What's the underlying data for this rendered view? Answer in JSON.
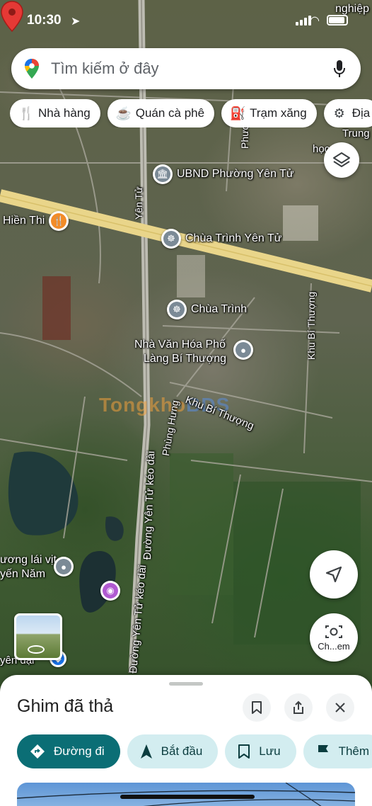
{
  "status_bar": {
    "time": "10:30"
  },
  "search": {
    "placeholder": "Tìm kiếm ở đây"
  },
  "chips": [
    {
      "label": "Nhà hàng",
      "icon": "restaurant-icon"
    },
    {
      "label": "Quán cà phê",
      "icon": "coffee-icon"
    },
    {
      "label": "Trạm xăng",
      "icon": "gas-station-icon"
    },
    {
      "label": "Địa",
      "icon": "attractions-icon"
    }
  ],
  "map": {
    "labels": {
      "top_right": "nghiệp",
      "trung": "Trung",
      "ho_ngo": "học Ngô",
      "ubnd": "UBND Phường Yên Tử",
      "yen_tu_road": "Yên Tử",
      "phuong_road": "Phương",
      "hien_thi": "Hiền Thi",
      "chua_trinh_yen_tu": "Chùa Trình Yên Tử",
      "chua_trinh": "Chùa Trình",
      "nha_van_hoa": "Nhà Văn Hóa Phố",
      "lang_bi_thuong": "Làng Bí Thượng",
      "khu_bi_thuong_vertical": "Khu Bí Thượng",
      "khu_bi_thuong": "Khu Bí Thượng",
      "phung_hung": "Phùng Hưng",
      "duong_yen_tu_keo_dai_1": "Đường Yên Tử kéo dài",
      "duong_yen_tu_keo_dai_2": "Đường Yên Tử kéo dài",
      "luong_lai_vit": "ương lái vịt",
      "yen_nam": "yến Năm",
      "yen_dai": "yên đại"
    },
    "watermark": {
      "part1": "Tongkho",
      "part2": "BDS"
    }
  },
  "buttons": {
    "lens_label": "Ch...em"
  },
  "sheet": {
    "title": "Ghim đã thả",
    "actions": [
      {
        "label": "Đường đi",
        "icon": "directions-icon",
        "primary": true
      },
      {
        "label": "Bắt đầu",
        "icon": "navigation-icon",
        "primary": false
      },
      {
        "label": "Lưu",
        "icon": "bookmark-icon",
        "primary": false
      },
      {
        "label": "Thêm",
        "icon": "flag-icon",
        "primary": false
      }
    ]
  },
  "colors": {
    "primary": "#0b6e75",
    "chip_bg": "#d3edf0",
    "pin": "#e53935"
  }
}
